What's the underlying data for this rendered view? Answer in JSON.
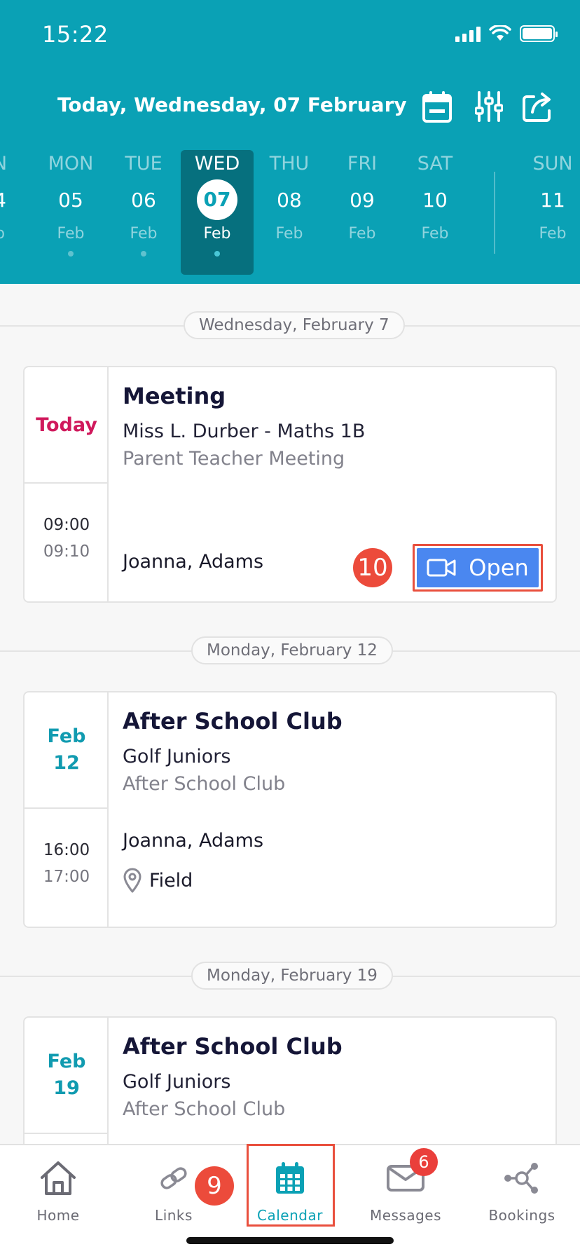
{
  "status_bar": {
    "time": "15:22"
  },
  "header": {
    "title": "Today, Wednesday, 07 February"
  },
  "week": [
    {
      "day": "N",
      "num": "4",
      "month": "b"
    },
    {
      "day": "MON",
      "num": "05",
      "month": "Feb"
    },
    {
      "day": "TUE",
      "num": "06",
      "month": "Feb"
    },
    {
      "day": "WED",
      "num": "07",
      "month": "Feb"
    },
    {
      "day": "THU",
      "num": "08",
      "month": "Feb"
    },
    {
      "day": "FRI",
      "num": "09",
      "month": "Feb"
    },
    {
      "day": "SAT",
      "num": "10",
      "month": "Feb"
    },
    {
      "day": "SUN",
      "num": "11",
      "month": "Feb"
    }
  ],
  "sections": [
    {
      "date_label": "Wednesday, February 7",
      "event": {
        "date_label": "Today",
        "title": "Meeting",
        "subtitle": "Miss L. Durber - Maths 1B",
        "type": "Parent Teacher Meeting",
        "start": "09:00",
        "end": "09:10",
        "people": "Joanna, Adams",
        "action_label": "Open"
      }
    },
    {
      "date_label": "Monday, February 12",
      "event": {
        "date_month": "Feb",
        "date_day": "12",
        "title": "After School Club",
        "subtitle": "Golf Juniors",
        "type": "After School Club",
        "start": "16:00",
        "end": "17:00",
        "people": "Joanna, Adams",
        "location": "Field"
      }
    },
    {
      "date_label": "Monday, February 19",
      "event": {
        "date_month": "Feb",
        "date_day": "19",
        "title": "After School Club",
        "subtitle": "Golf Juniors",
        "type": "After School Club"
      }
    }
  ],
  "tutorial_steps": {
    "open_step": "10",
    "calendar_step": "9"
  },
  "tabs": [
    {
      "label": "Home",
      "icon": "home-icon"
    },
    {
      "label": "Links",
      "icon": "link-icon"
    },
    {
      "label": "Calendar",
      "icon": "calendar-icon"
    },
    {
      "label": "Messages",
      "icon": "mail-icon",
      "badge": "6"
    },
    {
      "label": "Bookings",
      "icon": "network-icon"
    }
  ],
  "colors": {
    "header": "#0aa1b5",
    "selected_day": "#06707e",
    "today": "#d0195c",
    "accent": "#119bb0",
    "open_button": "#4a87f0",
    "highlight": "#e94f3d"
  }
}
